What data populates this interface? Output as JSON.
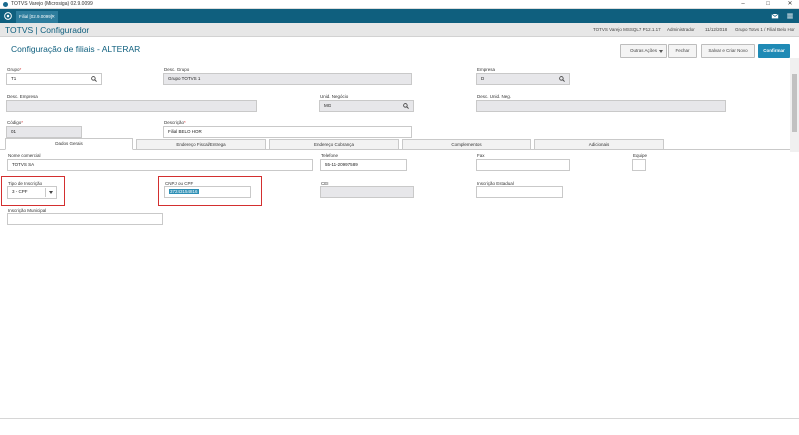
{
  "window": {
    "title": "TOTVS Varejo (Microsiga) 02.9.0099",
    "minimize": "–",
    "maximize": "□",
    "close": "✕"
  },
  "tabbar": {
    "tab_label": "Filial [02.9.0099]",
    "tab_close": "✕"
  },
  "header": {
    "brand": "TOTVS | Configurador",
    "env": "TOTVS Varejo MSSQL7 P12.1.17",
    "user": "Administrador",
    "date": "11/12/2018",
    "group": "Grupo Totvs 1 / Filial Belo Hor"
  },
  "page": {
    "title": "Configuração de filiais - ALTERAR",
    "buttons": {
      "other_actions": "Outras Ações",
      "close": "Fechar",
      "save_new": "Salvar e Criar Novo",
      "confirm": "Confirmar"
    }
  },
  "form": {
    "grupo": {
      "label": "Grupo",
      "value": "T1"
    },
    "desc_grupo": {
      "label": "Desc. Grupo",
      "value": "Grupo TOTVS 1"
    },
    "empresa": {
      "label": "Empresa",
      "value": "D"
    },
    "desc_empresa": {
      "label": "Desc. Empresa",
      "value": ""
    },
    "unid_negocio": {
      "label": "Unid. Negócio",
      "value": "MG"
    },
    "desc_unid_neg": {
      "label": "Desc. Unid. Neg.",
      "value": ""
    },
    "codigo": {
      "label": "Código",
      "value": "01"
    },
    "descricao": {
      "label": "Descrição",
      "value": "Filial BELO HOR"
    },
    "required_mark": "*"
  },
  "tabs": [
    "Dados Gerais",
    "Endereço Fiscal/Entrega",
    "Endereço Cobrança",
    "Complementos",
    "Adicionais"
  ],
  "dados_gerais": {
    "nome_comercial": {
      "label": "Nome comercial",
      "value": "TOTVS SA"
    },
    "telefone": {
      "label": "Telefone",
      "value": "55-11-20997589"
    },
    "fax": {
      "label": "Fax",
      "value": ""
    },
    "equipe": {
      "label": "Equipe",
      "value": ""
    },
    "tipo_inscricao": {
      "label": "Tipo de Inscrição",
      "value": "3 - CPF"
    },
    "cnpj_cpf": {
      "label": "CNPJ ou CPF",
      "value": "37243154816"
    },
    "cei": {
      "label": "CEI",
      "value": ""
    },
    "inscricao_estadual": {
      "label": "Inscrição Estadual",
      "value": ""
    },
    "inscricao_municipal": {
      "label": "Inscrição Municipal",
      "value": ""
    }
  },
  "colors": {
    "brand": "#0f5f7e",
    "accent": "#1f8ab5",
    "highlight": "#d32f2f"
  },
  "icons": [
    "search-icon",
    "chevron-down-icon",
    "home-icon",
    "mail-icon",
    "menu-icon"
  ]
}
